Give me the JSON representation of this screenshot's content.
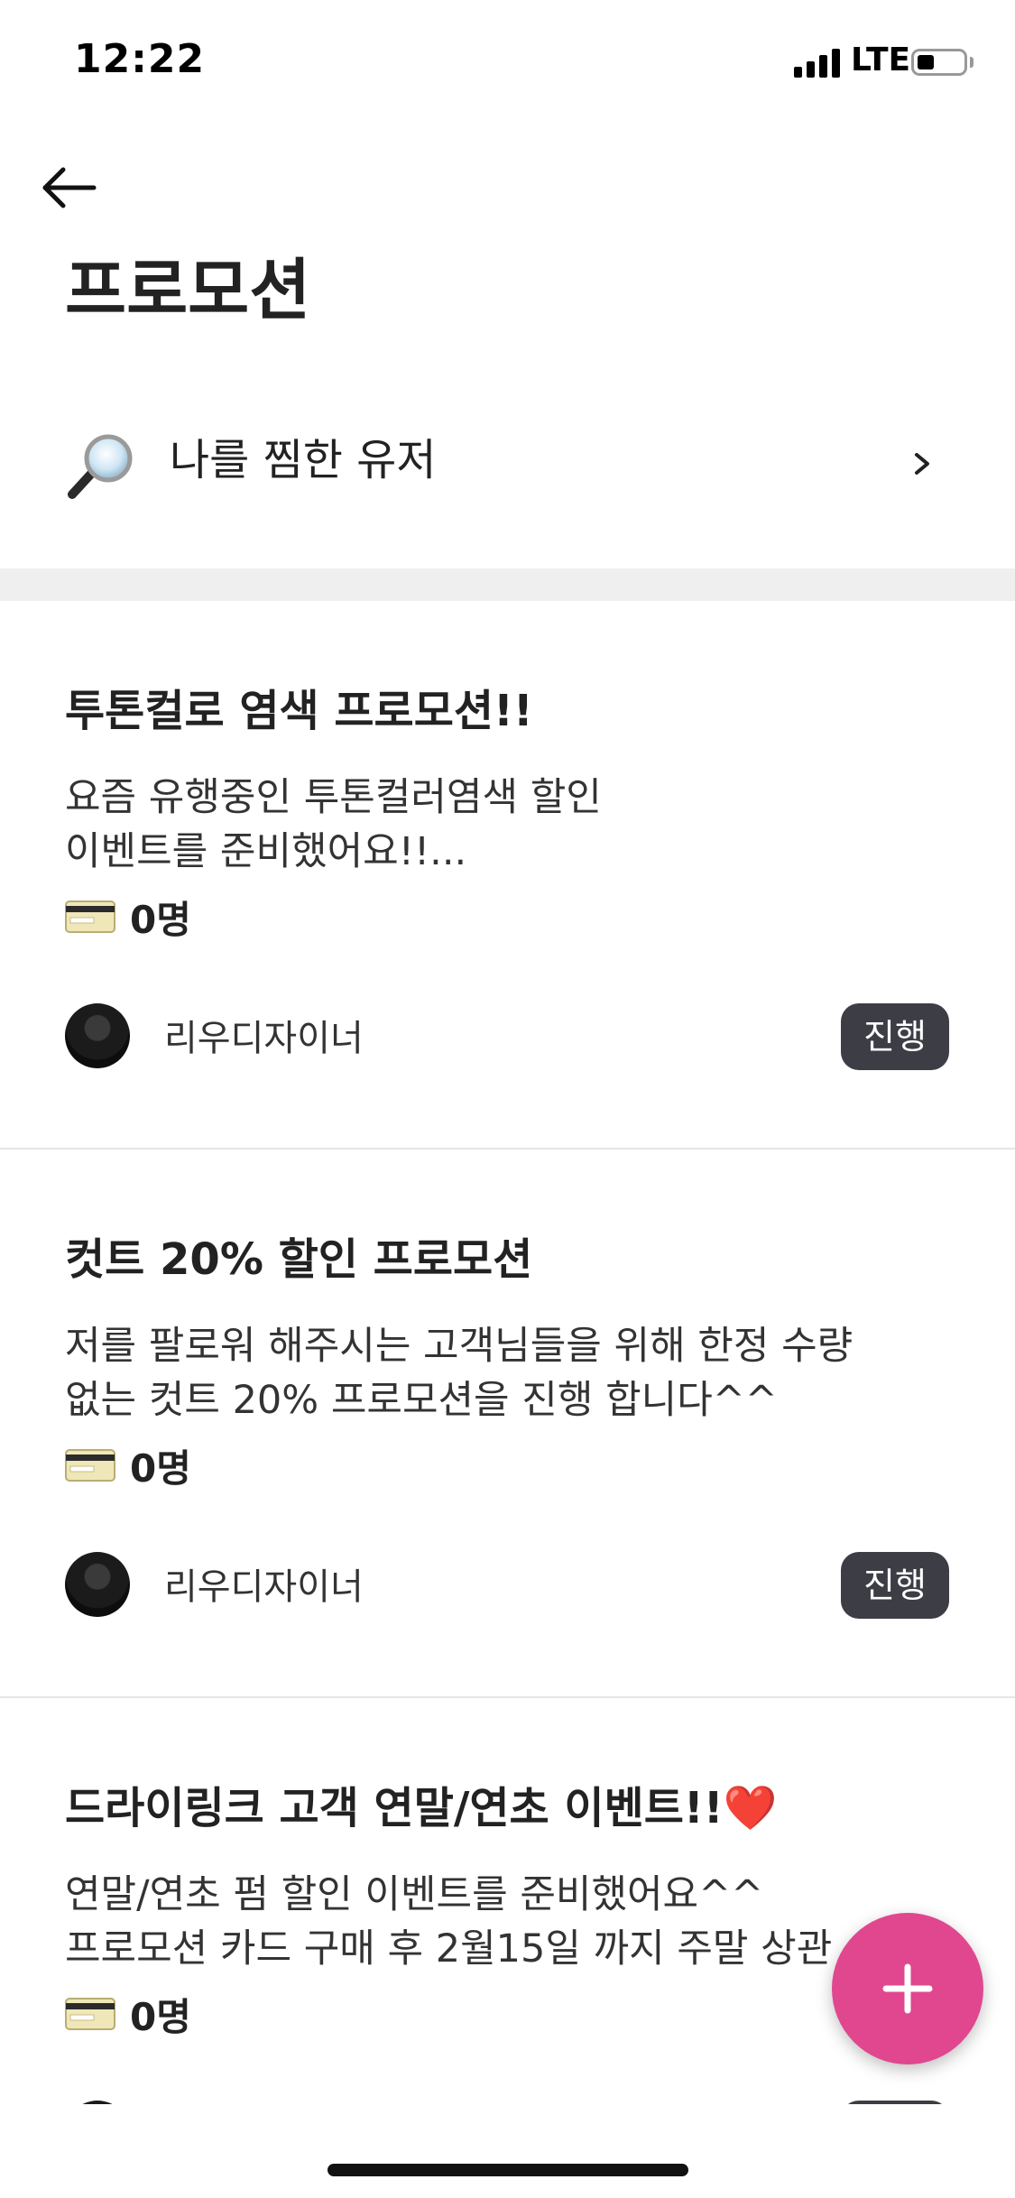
{
  "status_bar": {
    "time": "12:22",
    "network": "LTE"
  },
  "header": {
    "title": "프로모션"
  },
  "favorite_users": {
    "label": "나를 찜한 유저",
    "icon": "magnifier-icon"
  },
  "promotions": [
    {
      "title": "투톤컬로 염색 프로모션!!",
      "description_lines": [
        "요즘 유행중인 투톤컬러염색 할인",
        "이벤트를 준비했어요!!..."
      ],
      "count": "0명",
      "designer": "리우디자이너",
      "status": "진행"
    },
    {
      "title": "컷트 20% 할인 프로모션",
      "description_lines": [
        "저를 팔로워 해주시는 고객님들을 위해 한정 수량",
        "없는 컷트 20% 프로모션을 진행 합니다^^"
      ],
      "count": "0명",
      "designer": "리우디자이너",
      "status": "진행"
    },
    {
      "title": "드라이링크 고객 연말/연초 이벤트!!❤️",
      "description_lines": [
        "연말/연초 펌 할인 이벤트를 준비했어요^^",
        "프로모션 카드 구매 후 2월15일 까지 주말 상관"
      ],
      "count": "0명",
      "designer": "",
      "status": ""
    }
  ],
  "fab": {
    "icon": "plus-icon",
    "color": "#e0478f"
  }
}
